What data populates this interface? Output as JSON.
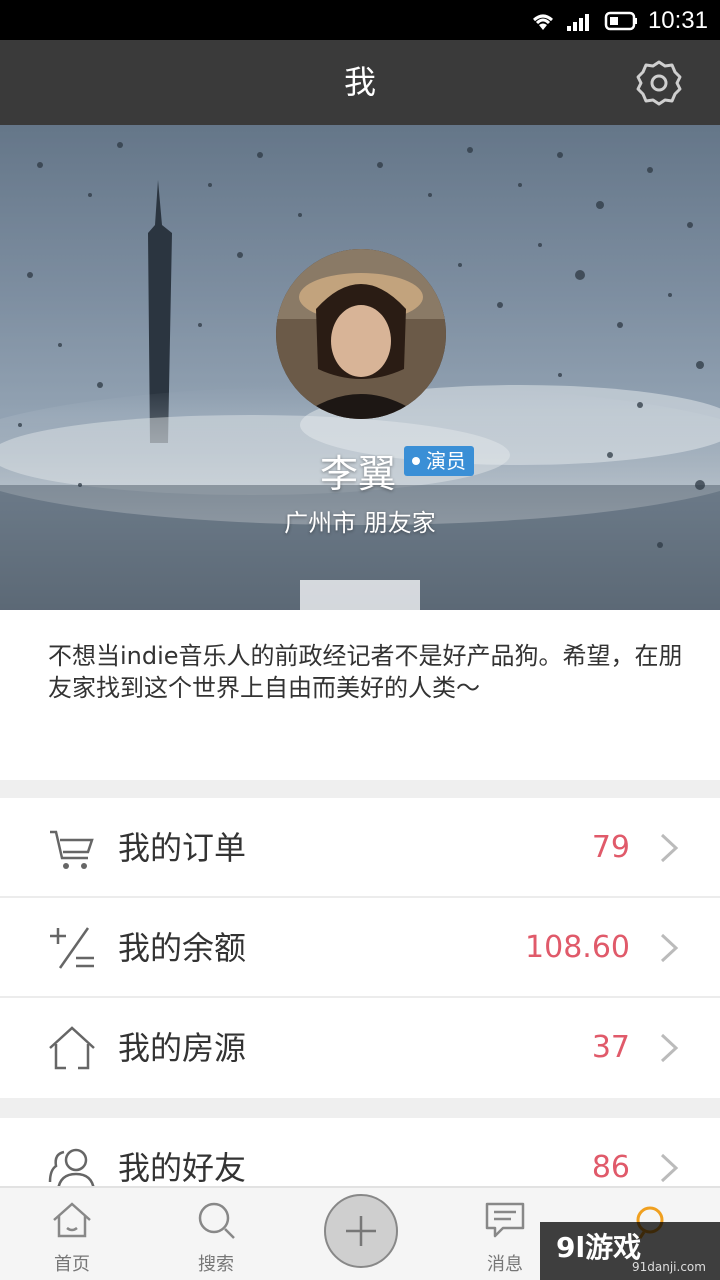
{
  "status_bar": {
    "time": "10:31"
  },
  "header": {
    "title": "我"
  },
  "profile": {
    "name": "李翼",
    "role": "演员",
    "location": "广州市  朋友家",
    "bio": "不想当indie音乐人的前政经记者不是好产品狗。希望，在朋友家找到这个世界上自由而美好的人类～"
  },
  "menu": {
    "orders": {
      "label": "我的订单",
      "value": "79"
    },
    "balance": {
      "label": "我的余额",
      "value": "108.60"
    },
    "listings": {
      "label": "我的房源",
      "value": "37"
    },
    "friends": {
      "label": "我的好友",
      "value": "86"
    }
  },
  "tabs": {
    "home": "首页",
    "search": "搜索",
    "messages": "消息"
  },
  "watermark": {
    "logo": "9l游戏",
    "url": "91danji.com"
  },
  "colors": {
    "accent_value": "#e05a6a",
    "header_bg": "#3a3a3a",
    "badge": "#3a8fd6",
    "active_tab": "#f0a020"
  }
}
